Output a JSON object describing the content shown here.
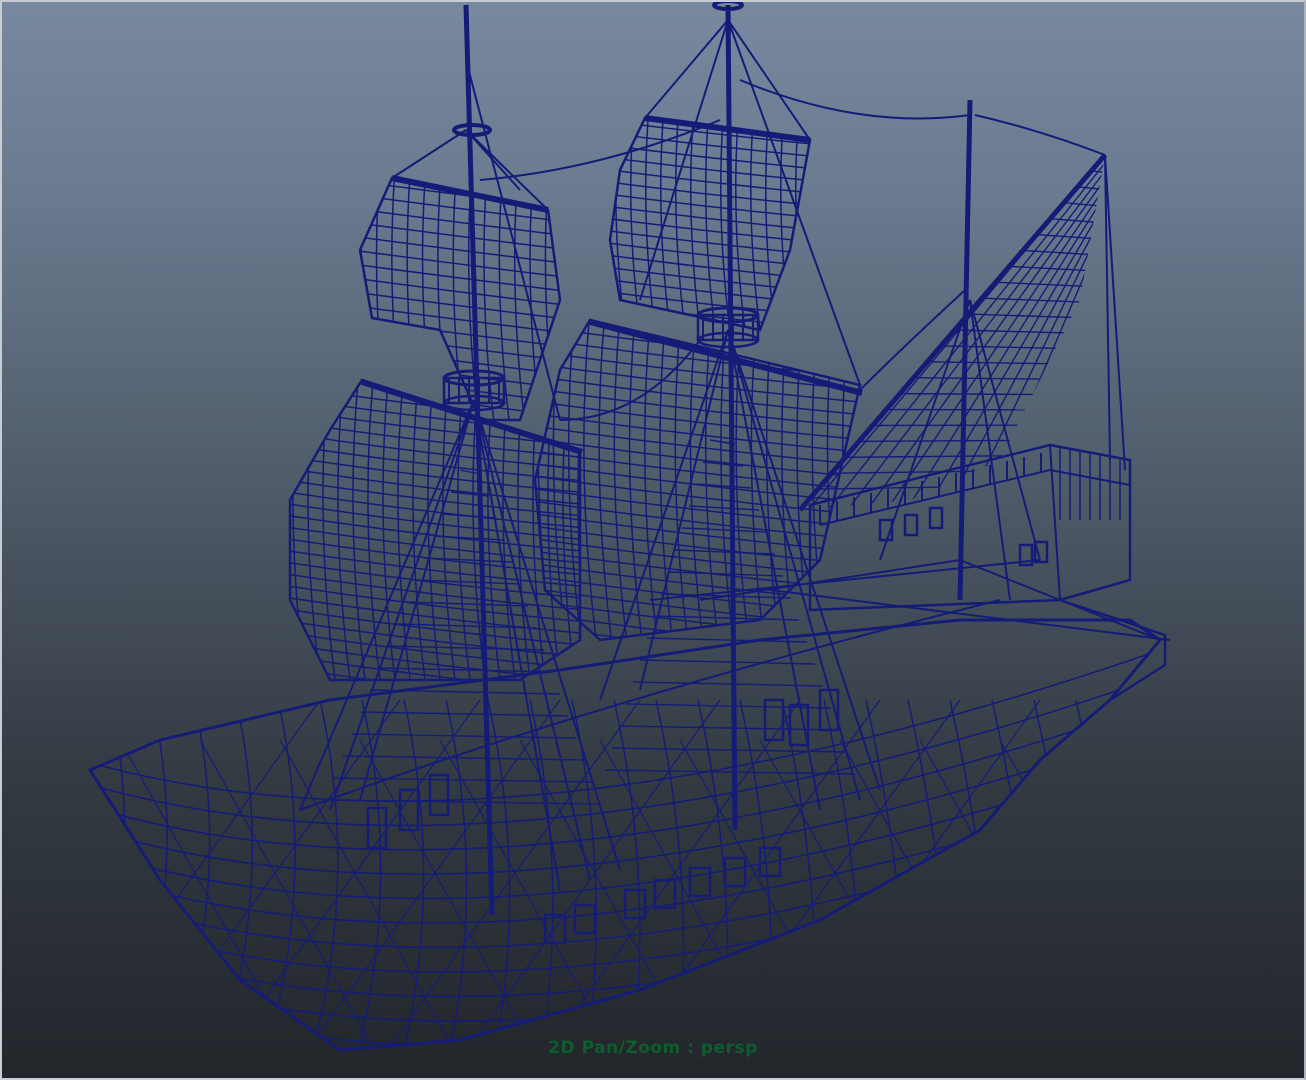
{
  "viewport": {
    "camera_mode_label": "2D Pan/Zoom : persp",
    "hud_color": "#0d5e2c",
    "wire_color": "#141c78",
    "background_top": "#7889a0",
    "background_bottom": "#22262b"
  },
  "model": {
    "icon": "sailing-ship-wireframe"
  }
}
